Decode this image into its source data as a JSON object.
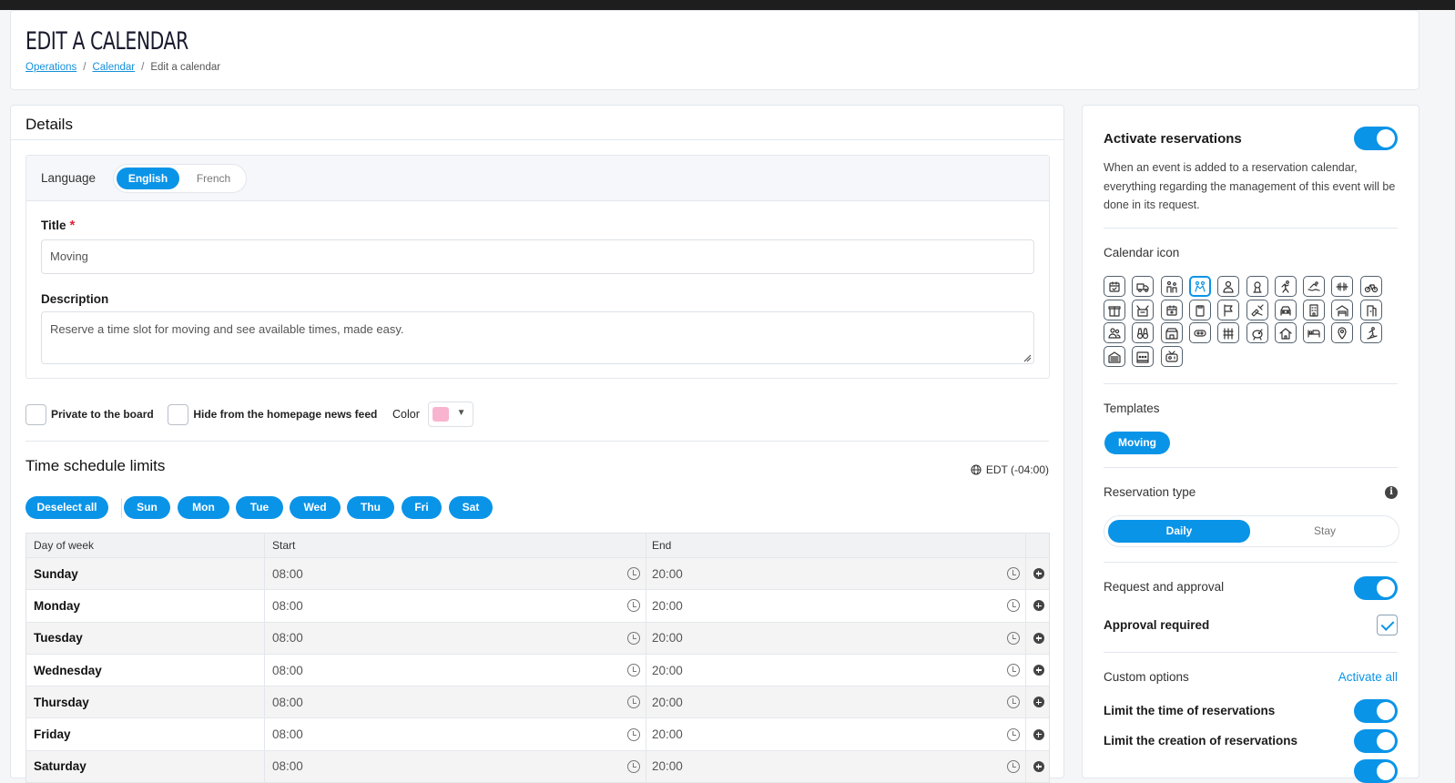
{
  "page": {
    "title": "EDIT A CALENDAR",
    "breadcrumb": [
      "Operations",
      "Calendar",
      "Edit a calendar"
    ]
  },
  "details": {
    "title": "Details",
    "language": {
      "label": "Language",
      "options": [
        "English",
        "French"
      ],
      "selected": "English"
    },
    "title_field": {
      "label": "Title",
      "value": "Moving"
    },
    "description_field": {
      "label": "Description",
      "value": "Reserve a time slot for moving and see available times, made easy."
    },
    "private_label": "Private to the board",
    "hide_label": "Hide from the homepage news feed",
    "color_label": "Color",
    "color_value": "#f8b4cf",
    "accent_color": "#0a94e8"
  },
  "schedule": {
    "title": "Time schedule limits",
    "timezone": "EDT (-04:00)",
    "deselect_label": "Deselect all",
    "days_short": [
      "Sun",
      "Mon",
      "Tue",
      "Wed",
      "Thu",
      "Fri",
      "Sat"
    ],
    "headers": [
      "Day of week",
      "Start",
      "End"
    ],
    "rows": [
      {
        "day": "Sunday",
        "start": "08:00",
        "end": "20:00"
      },
      {
        "day": "Monday",
        "start": "08:00",
        "end": "20:00"
      },
      {
        "day": "Tuesday",
        "start": "08:00",
        "end": "20:00"
      },
      {
        "day": "Wednesday",
        "start": "08:00",
        "end": "20:00"
      },
      {
        "day": "Thursday",
        "start": "08:00",
        "end": "20:00"
      },
      {
        "day": "Friday",
        "start": "08:00",
        "end": "20:00"
      },
      {
        "day": "Saturday",
        "start": "08:00",
        "end": "20:00"
      }
    ]
  },
  "sidebar": {
    "activate_title": "Activate reservations",
    "activate_desc": "When an event is added to a reservation calendar, everything regarding the management of this event will be done in its request.",
    "calendar_icon_label": "Calendar icon",
    "icon_names": [
      "calendar-check-icon",
      "truck-icon",
      "family-icon",
      "people-icon",
      "user-icon",
      "certificate-icon",
      "running-icon",
      "swimming-icon",
      "dumbbell-icon",
      "bicycle-icon",
      "package-icon",
      "box-open-icon",
      "calendar-icon",
      "clipboard-icon",
      "flag-icon",
      "tools-icon",
      "car-icon",
      "building-icon",
      "garage-icon",
      "door-icon",
      "group-icon",
      "binoculars-icon",
      "store-icon",
      "ticket-icon",
      "grid-icon",
      "piggy-bank-icon",
      "house-icon",
      "bed-icon",
      "map-pin-icon",
      "skiing-icon",
      "parking-icon",
      "dots-grid-icon",
      "tv-icon"
    ],
    "templates_label": "Templates",
    "template": "Moving",
    "reservation_type_label": "Reservation type",
    "reservation_options": [
      "Daily",
      "Stay"
    ],
    "request_label": "Request and approval",
    "approval_label": "Approval required",
    "custom_label": "Custom options",
    "activate_all": "Activate all",
    "limit_time": "Limit the time of reservations",
    "limit_creation": "Limit the creation of reservations"
  }
}
